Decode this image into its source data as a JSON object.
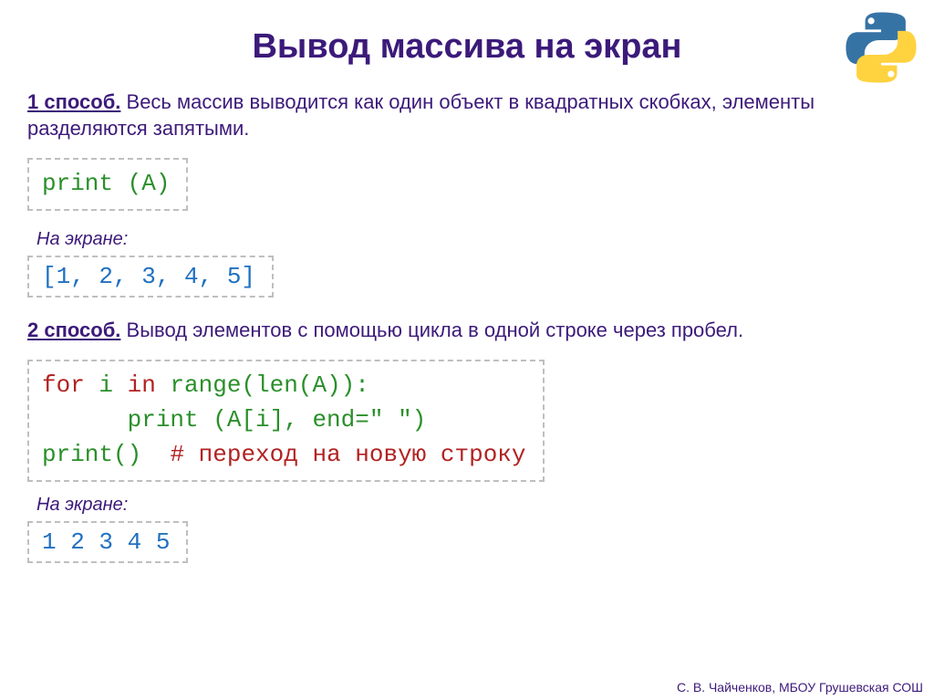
{
  "title": "Вывод массива на экран",
  "method1": {
    "label": "1 способ.",
    "text": " Весь массив выводится как один объект в квадратных скобках, элементы разделяются запятыми.",
    "code": "print (A)",
    "caption": "На экране:",
    "output": "[1, 2, 3, 4, 5]"
  },
  "method2": {
    "label": "2 способ.",
    "text": " Вывод элементов с помощью цикла в одной строке через пробел.",
    "code": {
      "l1a": "for",
      "l1b": " i ",
      "l1c": "in",
      "l1d": " range(len(A)):",
      "l2": "      print (A[i], end=\" \")",
      "l3a": "print()  ",
      "l3b": "# переход на новую строку"
    },
    "caption": "На экране:",
    "output": "1 2 3 4 5"
  },
  "footer": "С. В. Чайченков, МБОУ Грушевская СОШ"
}
